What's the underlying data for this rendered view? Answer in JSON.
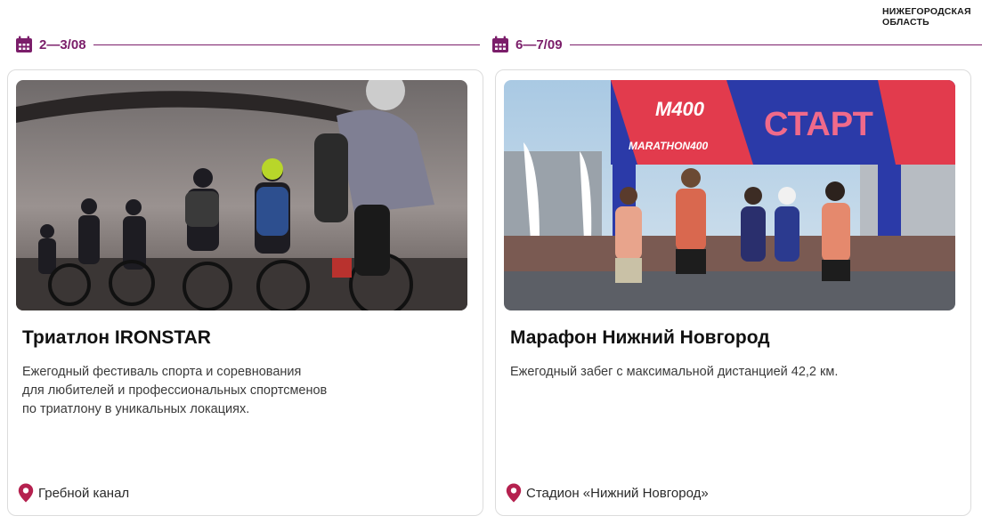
{
  "header": {
    "region_line1": "НИЖЕГОРОДСКАЯ",
    "region_line2": "ОБЛАСТЬ"
  },
  "colors": {
    "accent": "#7b1e6a",
    "pin": "#b5214f",
    "card_border": "#dcdcdc"
  },
  "events": [
    {
      "date": "2—3/08",
      "title": "Триатлон IRONSTAR",
      "description_lines": [
        "Ежегодный фестиваль спорта и соревнования",
        "для любителей и профессиональных спортсменов",
        "по триатлону в уникальных локациях."
      ],
      "location": "Гребной канал",
      "icons": {
        "date": "calendar-icon",
        "location": "map-pin-icon"
      }
    },
    {
      "date": "6—7/09",
      "title": "Марафон Нижний Новгород",
      "description_lines": [
        "Ежегодный забег с максимальной дистанцией 42,2 км."
      ],
      "location": "Стадион «Нижний Новгород»",
      "photo_banner": {
        "start_text": "СТАРТ",
        "brand_short": "M400",
        "brand_long": "MARATHON400"
      },
      "icons": {
        "date": "calendar-icon",
        "location": "map-pin-icon"
      }
    }
  ]
}
